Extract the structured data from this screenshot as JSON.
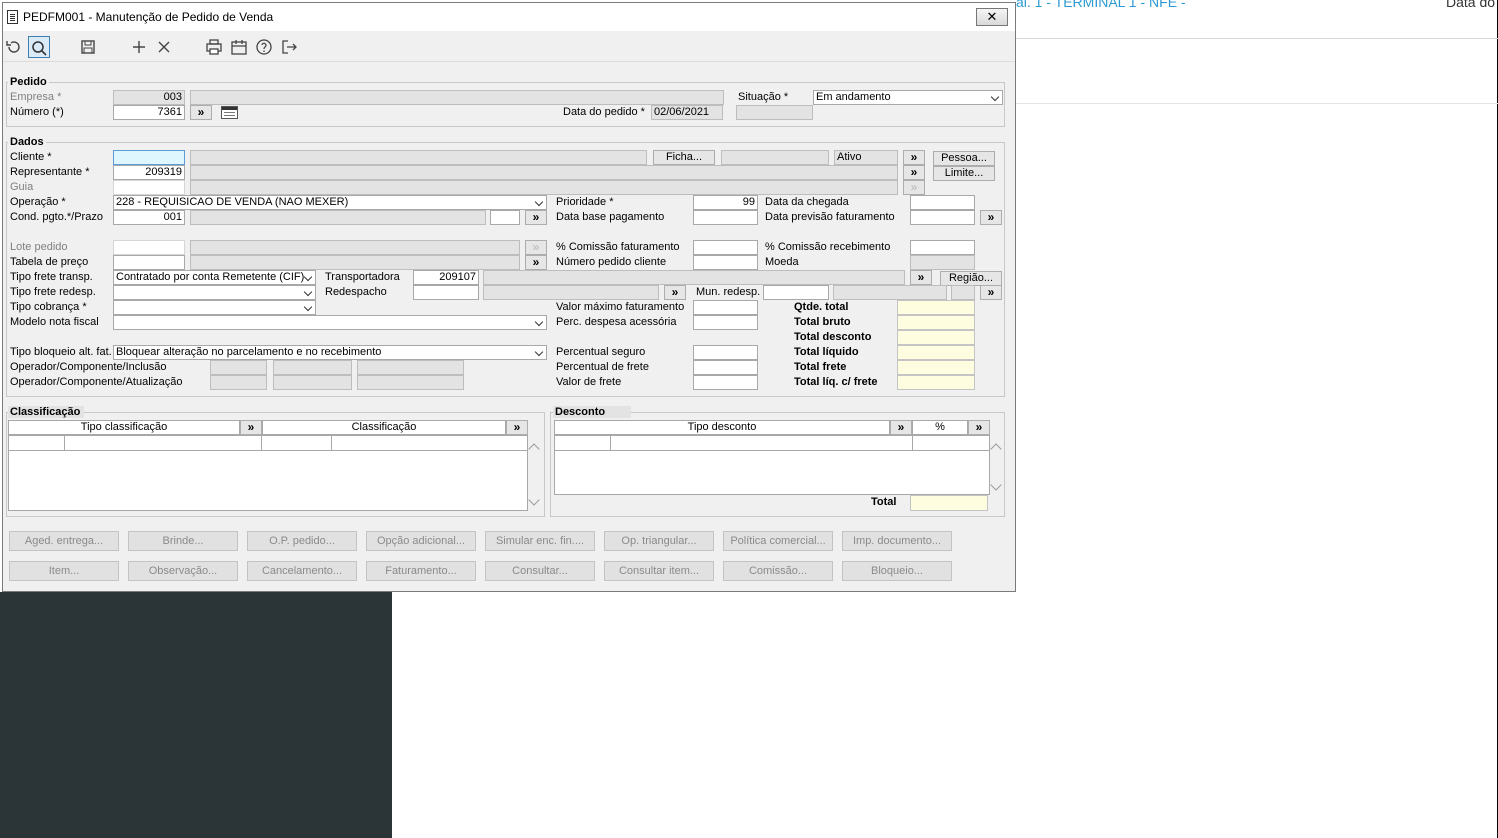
{
  "background": {
    "top_text": "al. 1 - TERMINAL 1 - NFE -",
    "top_right_text": "Data do"
  },
  "window": {
    "title": "PEDFM001 - Manutenção de Pedido de Venda",
    "close_label": "✕"
  },
  "toolbar": {
    "icons": [
      "undo-icon",
      "search-icon",
      "save-icon",
      "add-icon",
      "delete-icon",
      "print-icon",
      "calendar-icon",
      "help-icon",
      "exit-icon"
    ]
  },
  "pedido": {
    "title": "Pedido",
    "empresa_label": "Empresa *",
    "empresa_value": "003",
    "numero_label": "Número (*)",
    "numero_value": "7361",
    "situacao_label": "Situação *",
    "situacao_value": "Em andamento",
    "data_label": "Data do pedido *",
    "data_value": "02/06/2021"
  },
  "dados": {
    "title": "Dados",
    "cliente_label": "Cliente *",
    "ficha_label": "Ficha...",
    "ativo_value": "Ativo",
    "pessoa_label": "Pessoa...",
    "representante_label": "Representante *",
    "representante_value": "209319",
    "limite_label": "Limite...",
    "guia_label": "Guia",
    "operacao_label": "Operação *",
    "operacao_value": "228 - REQUISICAO DE VENDA (NAO MEXER)",
    "prioridade_label": "Prioridade *",
    "prioridade_value": "99",
    "data_chegada_label": "Data da chegada",
    "cond_label": "Cond. pgto.*/Prazo",
    "cond_value": "001",
    "data_base_label": "Data base pagamento",
    "data_prev_label": "Data previsão faturamento",
    "lote_label": "Lote pedido",
    "comissao_fat_label": "% Comissão faturamento",
    "comissao_rec_label": "% Comissão recebimento",
    "tabela_label": "Tabela de preço",
    "num_ped_cliente_label": "Número pedido cliente",
    "moeda_label": "Moeda",
    "tipo_frete_label": "Tipo frete transp.",
    "tipo_frete_value": "Contratado por conta Remetente (CIF)",
    "transportadora_label": "Transportadora",
    "transportadora_value": "209107",
    "regiao_label": "Região...",
    "tipo_frete_redesp_label": "Tipo frete redesp.",
    "redespacho_label": "Redespacho",
    "mun_redesp_label": "Mun. redesp.",
    "tipo_cobranca_label": "Tipo cobrança *",
    "valor_max_label": "Valor máximo faturamento",
    "modelo_nf_label": "Modelo nota fiscal",
    "perc_despesa_label": "Perc. despesa acessória",
    "tipo_bloqueio_label": "Tipo bloqueio alt. fat.",
    "tipo_bloqueio_value": "Bloquear alteração no parcelamento e no recebimento",
    "perc_seguro_label": "Percentual seguro",
    "op_inclusao_label": "Operador/Componente/Inclusão",
    "perc_frete_label": "Percentual de frete",
    "op_atualizacao_label": "Operador/Componente/Atualização",
    "valor_frete_label": "Valor de frete",
    "arrow": "»"
  },
  "totals": {
    "qtde_total": "Qtde. total",
    "total_bruto": "Total bruto",
    "total_desconto": "Total desconto",
    "total_liquido": "Total líquido",
    "total_frete": "Total frete",
    "total_liq_frete": "Total líq. c/ frete"
  },
  "classificacao": {
    "title": "Classificação",
    "col1": "Tipo classificação",
    "col2": "Classificação"
  },
  "desconto": {
    "title": "Desconto",
    "col1": "Tipo desconto",
    "col2": "%",
    "total_label": "Total"
  },
  "buttons_row1": [
    "Aged. entrega...",
    "Brinde...",
    "O.P. pedido...",
    "Opção adicional...",
    "Simular enc. fin....",
    "Op. triangular...",
    "Política comercial...",
    "Imp. documento..."
  ],
  "buttons_row2": [
    "Item...",
    "Observação...",
    "Cancelamento...",
    "Faturamento...",
    "Consultar...",
    "Consultar item...",
    "Comissão...",
    "Bloqueio..."
  ]
}
